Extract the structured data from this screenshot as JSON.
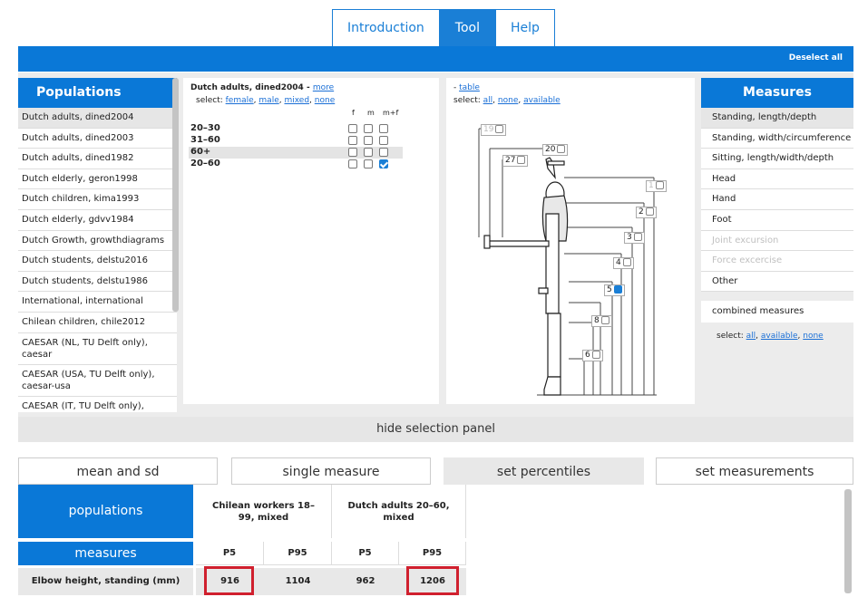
{
  "top_tabs": [
    {
      "label": "Introduction",
      "active": false
    },
    {
      "label": "Tool",
      "active": true
    },
    {
      "label": "Help",
      "active": false
    }
  ],
  "deselect_all": "Deselect all",
  "populations": {
    "header": "Populations",
    "items": [
      "Dutch adults, dined2004",
      "Dutch adults, dined2003",
      "Dutch adults, dined1982",
      "Dutch elderly, geron1998",
      "Dutch children, kima1993",
      "Dutch elderly, gdvv1984",
      "Dutch Growth, growthdiagrams",
      "Dutch students, delstu2016",
      "Dutch students, delstu1986",
      "International, international",
      "Chilean children, chile2012",
      "CAESAR (NL, TU Delft only), caesar",
      "CAESAR (USA, TU Delft only), caesar-usa",
      "CAESAR (IT, TU Delft only),"
    ],
    "selected_index": 0
  },
  "subgroups": {
    "title": "Dutch adults, dined2004 - ",
    "more_link": "more",
    "select_label": "select: ",
    "select_links": [
      "female",
      "male",
      "mixed",
      "none"
    ],
    "column_headers": [
      "f",
      "m",
      "m+f"
    ],
    "rows": [
      {
        "label": "20–30",
        "checks": [
          false,
          false,
          false
        ],
        "highlight": false
      },
      {
        "label": "31–60",
        "checks": [
          false,
          false,
          false
        ],
        "highlight": false
      },
      {
        "label": "60+",
        "checks": [
          false,
          false,
          false
        ],
        "highlight": true
      },
      {
        "label": "20–60",
        "checks": [
          false,
          false,
          true
        ],
        "highlight": false
      }
    ]
  },
  "figure": {
    "table_prefix": "- ",
    "table_link": "table",
    "select_label": "select: ",
    "select_links": [
      "all",
      "none",
      "available"
    ],
    "markers": [
      {
        "label": "19",
        "checked": false,
        "enabled": false
      },
      {
        "label": "20",
        "checked": false,
        "enabled": true
      },
      {
        "label": "27",
        "checked": false,
        "enabled": true
      },
      {
        "label": "1",
        "checked": false,
        "enabled": false
      },
      {
        "label": "2",
        "checked": false,
        "enabled": true
      },
      {
        "label": "3",
        "checked": false,
        "enabled": true
      },
      {
        "label": "4",
        "checked": false,
        "enabled": true
      },
      {
        "label": "5",
        "checked": true,
        "enabled": true
      },
      {
        "label": "8",
        "checked": false,
        "enabled": true
      },
      {
        "label": "6",
        "checked": false,
        "enabled": true
      }
    ]
  },
  "measures": {
    "header": "Measures",
    "items": [
      {
        "label": "Standing, length/depth",
        "selected": true,
        "disabled": false
      },
      {
        "label": "Standing, width/circumference",
        "selected": false,
        "disabled": false
      },
      {
        "label": "Sitting, length/width/depth",
        "selected": false,
        "disabled": false
      },
      {
        "label": "Head",
        "selected": false,
        "disabled": false
      },
      {
        "label": "Hand",
        "selected": false,
        "disabled": false
      },
      {
        "label": "Foot",
        "selected": false,
        "disabled": false
      },
      {
        "label": "Joint excursion",
        "selected": false,
        "disabled": true
      },
      {
        "label": "Force excercise",
        "selected": false,
        "disabled": true
      },
      {
        "label": "Other",
        "selected": false,
        "disabled": false
      }
    ],
    "combined": "combined measures",
    "select_label": "select: ",
    "select_links": [
      "all",
      "available",
      "none"
    ]
  },
  "hide_panel": "hide selection panel",
  "result_tabs": [
    {
      "label": "mean and sd",
      "active": false
    },
    {
      "label": "single measure",
      "active": false
    },
    {
      "label": "set percentiles",
      "active": true
    },
    {
      "label": "set measurements",
      "active": false
    }
  ],
  "results": {
    "populations_label": "populations",
    "measures_label": "measures",
    "columns": [
      {
        "population": "Chilean workers 18–99, mixed",
        "percentiles": [
          "P5",
          "P95"
        ]
      },
      {
        "population": "Dutch adults 20–60, mixed",
        "percentiles": [
          "P5",
          "P95"
        ]
      }
    ],
    "rows": [
      {
        "measure": "Elbow height, standing (mm)",
        "values": [
          "916",
          "1104",
          "962",
          "1206"
        ]
      }
    ],
    "highlight_color": "#d0202e"
  },
  "colors": {
    "accent": "#0a78d7",
    "highlight": "#d0202e"
  }
}
